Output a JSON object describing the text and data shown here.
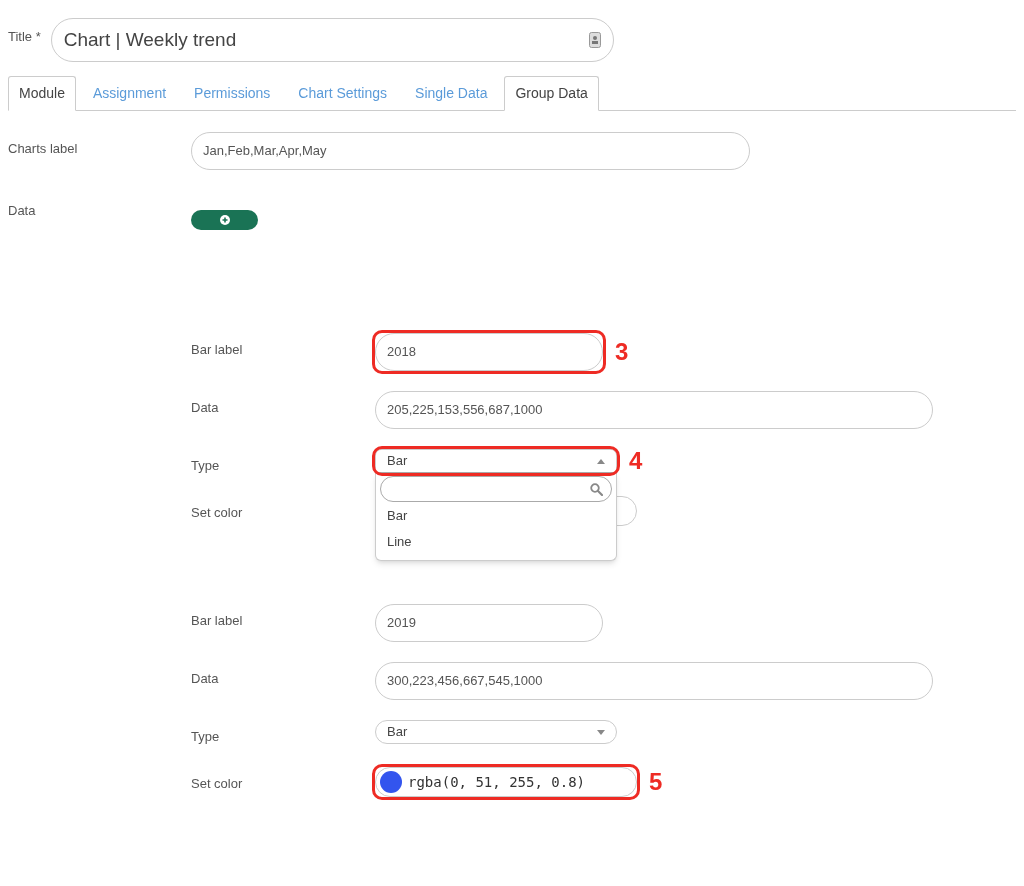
{
  "title_field": {
    "label": "Title *",
    "value": "Chart | Weekly trend"
  },
  "tabs": [
    {
      "label": "Module",
      "selected": true
    },
    {
      "label": "Assignment",
      "selected": false
    },
    {
      "label": "Permissions",
      "selected": false
    },
    {
      "label": "Chart Settings",
      "selected": false
    },
    {
      "label": "Single Data",
      "selected": false
    },
    {
      "label": "Group Data",
      "selected": true
    }
  ],
  "charts_label": {
    "label": "Charts label",
    "value": "Jan,Feb,Mar,Apr,May"
  },
  "data_label": "Data",
  "datasets": [
    {
      "bar_label": {
        "label": "Bar label",
        "value": "2018",
        "callout": "3"
      },
      "data": {
        "label": "Data",
        "value": "205,225,153,556,687,1000"
      },
      "type": {
        "label": "Type",
        "value": "Bar",
        "expanded": true,
        "options": [
          "Bar",
          "Line"
        ],
        "callout": "4"
      },
      "set_color": {
        "label": "Set color"
      }
    },
    {
      "bar_label": {
        "label": "Bar label",
        "value": "2019"
      },
      "data": {
        "label": "Data",
        "value": "300,223,456,667,545,1000"
      },
      "type": {
        "label": "Type",
        "value": "Bar",
        "expanded": false
      },
      "set_color": {
        "label": "Set color",
        "value": "rgba(0, 51, 255, 0.8)",
        "color": "#3355ee",
        "callout": "5"
      }
    }
  ]
}
